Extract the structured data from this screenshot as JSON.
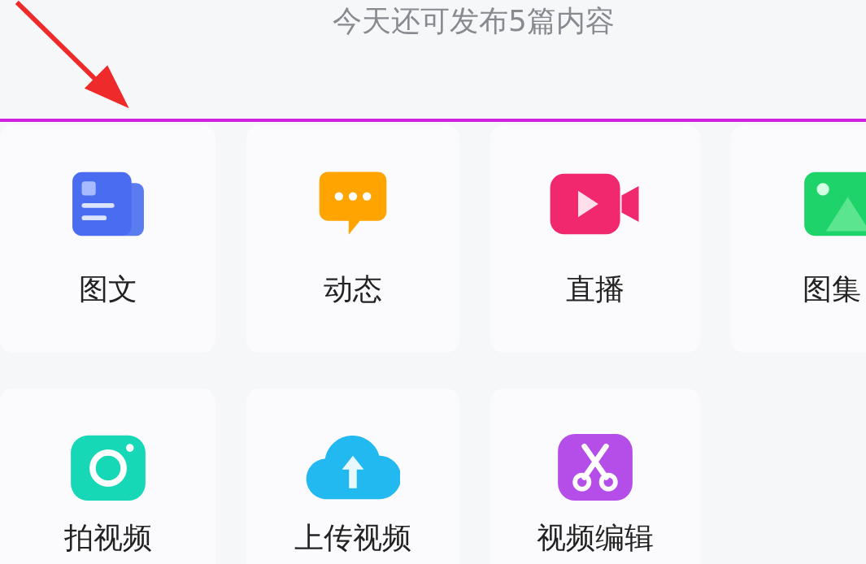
{
  "header": {
    "quota_text": "今天还可发布5篇内容"
  },
  "items": [
    {
      "label": "图文",
      "kind": "article"
    },
    {
      "label": "动态",
      "kind": "post"
    },
    {
      "label": "直播",
      "kind": "live"
    },
    {
      "label": "图集",
      "kind": "gallery"
    },
    {
      "label": "拍视频",
      "kind": "camera"
    },
    {
      "label": "上传视频",
      "kind": "upload"
    },
    {
      "label": "视频编辑",
      "kind": "edit"
    }
  ]
}
